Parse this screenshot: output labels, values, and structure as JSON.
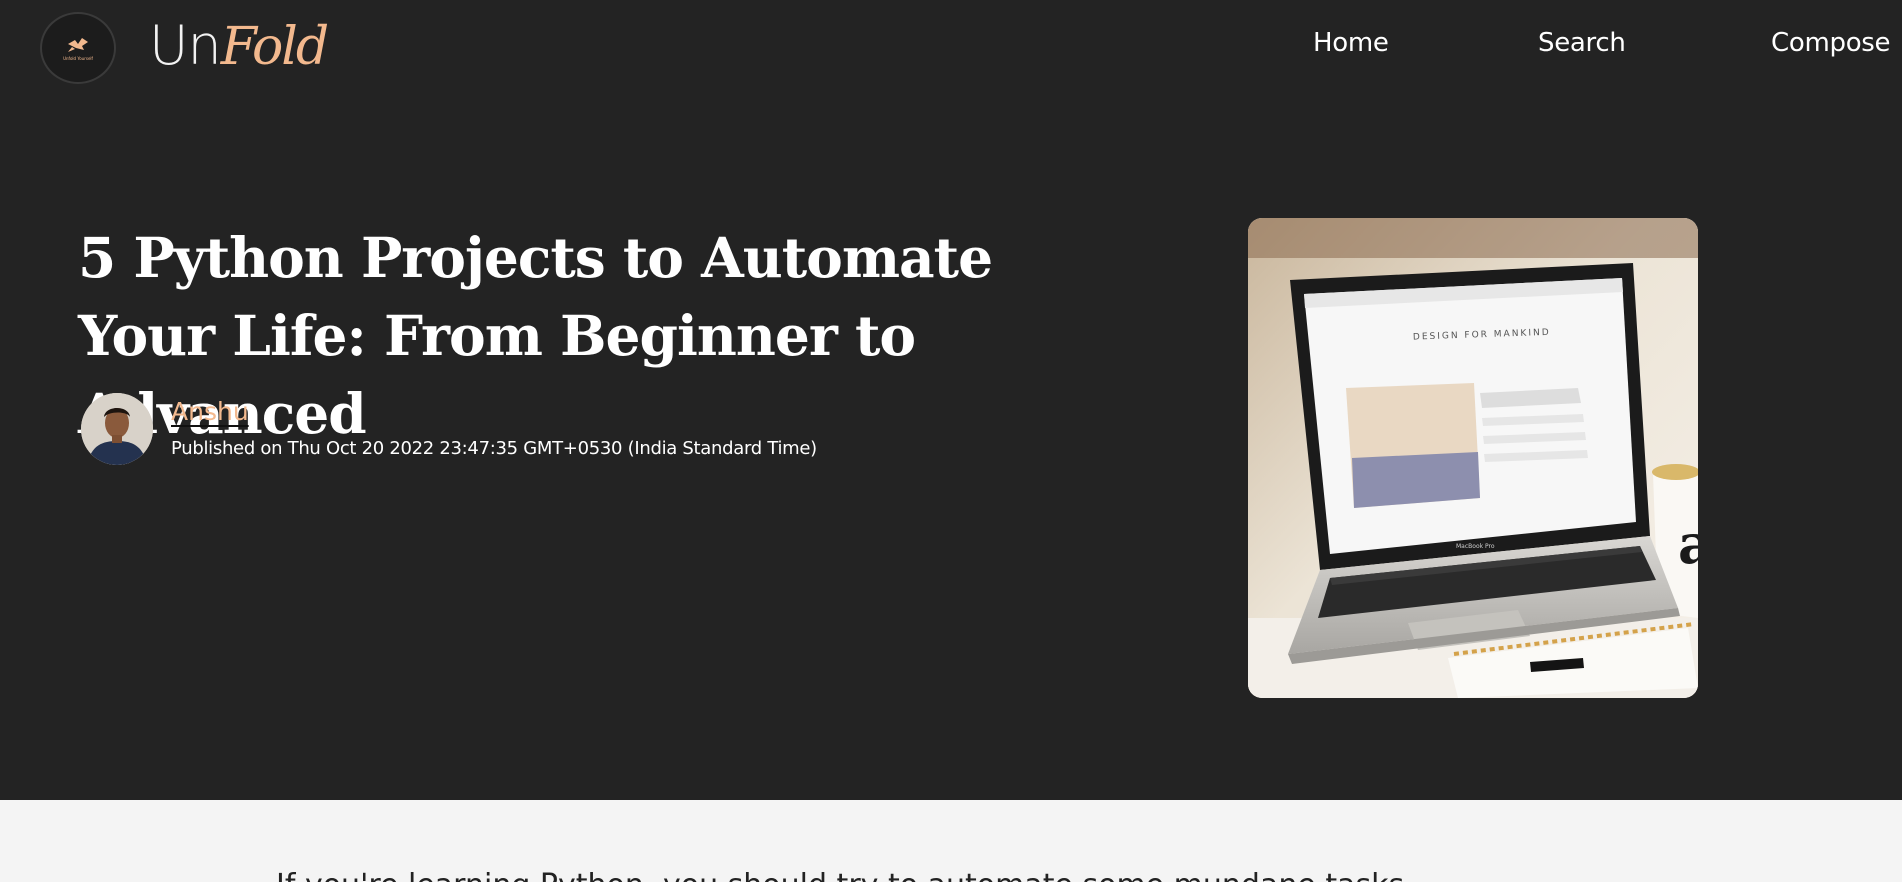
{
  "brand": {
    "name_part1": "Un",
    "name_part2": "Fold",
    "logo_text": "Unfold Yourself",
    "accent_color": "#f3b98e"
  },
  "nav": {
    "items": [
      {
        "label": "Home"
      },
      {
        "label": "Search"
      },
      {
        "label": "Compose"
      }
    ]
  },
  "article": {
    "title": "5 Python Projects to Automate Your Life: From Beginner to Advanced",
    "author": "Anshu",
    "published_prefix": "Published on ",
    "published_date": "Thu Oct 20 2022 23:47:35 GMT+0530 (India Standard Time)",
    "cover_screen_text": "DESIGN FOR MANKIND",
    "cover_laptop_label": "MacBook Pro",
    "body_first_line": "If you're learning Python, you should try to automate some mundane tasks"
  },
  "colors": {
    "hero_bg": "#232323",
    "content_bg": "#f4f4f4",
    "text_on_dark": "#ffffff"
  }
}
